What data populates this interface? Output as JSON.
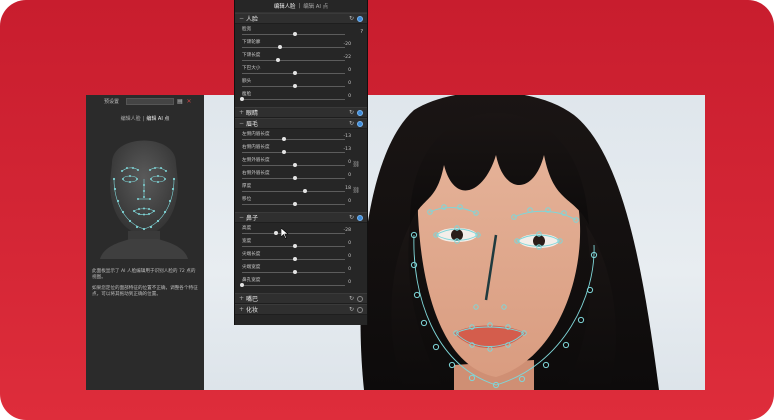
{
  "left_panel": {
    "preset_label": "预设置",
    "tabs": [
      "编辑人脸",
      "编辑 AI 点"
    ],
    "tab_separator": "|",
    "desc_1": "此面板显示了 AI 人脸编辑用于识别人脸的 72 点的视图。",
    "desc_2": "如果您定位的面部特征的位置不正确，调整各个特征点，可以将其拖动到正确的位置。"
  },
  "right_panel": {
    "tabs": [
      "编辑人脸",
      "编辑 AI 点"
    ],
    "tab_separator": "|",
    "sections": [
      {
        "title": "人脸",
        "expanded": true,
        "enabled": true,
        "sliders": [
          {
            "name": "脸宽",
            "value": "",
            "pos": 0.5,
            "help": "?"
          },
          {
            "name": "下颌轮廓",
            "value": "-20",
            "pos": 0.36
          },
          {
            "name": "下颌长度",
            "value": "-22",
            "pos": 0.34
          },
          {
            "name": "下巴大小",
            "value": "0",
            "pos": 0.5
          },
          {
            "name": "额头",
            "value": "0",
            "pos": 0.5
          },
          {
            "name": "瘦脸",
            "value": "0",
            "pos": 0.0
          }
        ]
      },
      {
        "title": "眼睛",
        "expanded": false,
        "enabled": true,
        "sliders": []
      },
      {
        "title": "眉毛",
        "expanded": true,
        "enabled": true,
        "sliders": [
          {
            "name": "左侧内眉长度",
            "value": "-13",
            "pos": 0.4
          },
          {
            "name": "右侧内眉长度",
            "value": "-13",
            "pos": 0.4
          },
          {
            "name": "左侧外眉长度",
            "value": "0",
            "pos": 0.5
          },
          {
            "name": "右侧外眉长度",
            "value": "0",
            "pos": 0.5
          },
          {
            "name": "厚度",
            "value": "18",
            "pos": 0.6
          },
          {
            "name": "移位",
            "value": "0",
            "pos": 0.5
          }
        ]
      },
      {
        "title": "鼻子",
        "expanded": true,
        "enabled": true,
        "sliders": [
          {
            "name": "高度",
            "value": "-28",
            "pos": 0.32
          },
          {
            "name": "宽度",
            "value": "0",
            "pos": 0.5
          },
          {
            "name": "尖端长度",
            "value": "0",
            "pos": 0.5
          },
          {
            "name": "尖端宽度",
            "value": "0",
            "pos": 0.5
          },
          {
            "name": "鼻孔宽度",
            "value": "0",
            "pos": 0.0
          }
        ]
      },
      {
        "title": "嘴巴",
        "expanded": false,
        "enabled": false,
        "sliders": []
      },
      {
        "title": "化妆",
        "expanded": false,
        "enabled": false,
        "sliders": []
      }
    ]
  },
  "colors": {
    "brand_red": "#d42535",
    "panel_dark": "#262626",
    "accent_blue": "#3d8bd9",
    "landmark": "#7fd6d8"
  }
}
